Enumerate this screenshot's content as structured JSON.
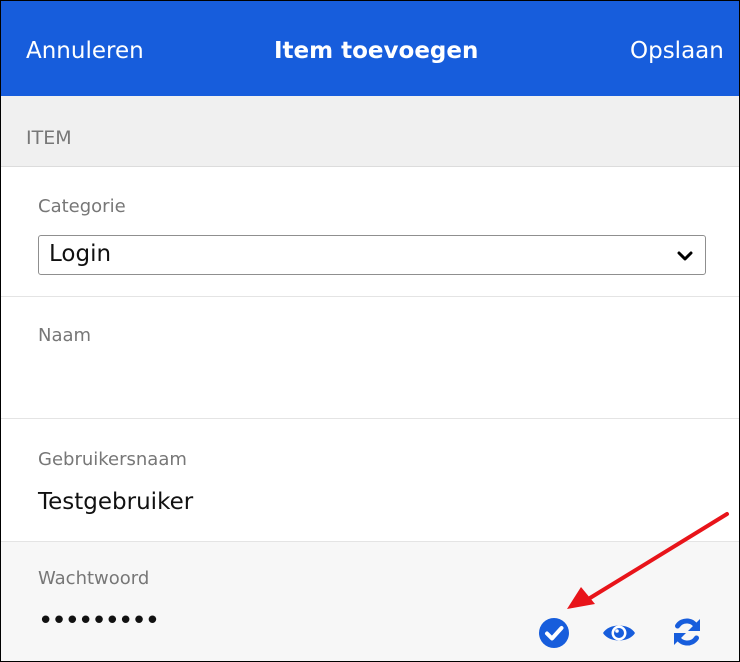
{
  "header": {
    "cancel_label": "Annuleren",
    "title": "Item toevoegen",
    "save_label": "Opslaan"
  },
  "section": {
    "title": "ITEM"
  },
  "fields": {
    "category": {
      "label": "Categorie",
      "value": "Login"
    },
    "name": {
      "label": "Naam",
      "value": ""
    },
    "username": {
      "label": "Gebruikersnaam",
      "value": "Testgebruiker"
    },
    "password": {
      "label": "Wachtwoord",
      "value_masked": "•••••••••",
      "icons": [
        "check-circle-icon",
        "eye-icon",
        "sync-icon"
      ]
    }
  },
  "colors": {
    "header_bg": "#175ddc",
    "icon": "#175ddc",
    "annotation_arrow": "#e8141a"
  }
}
